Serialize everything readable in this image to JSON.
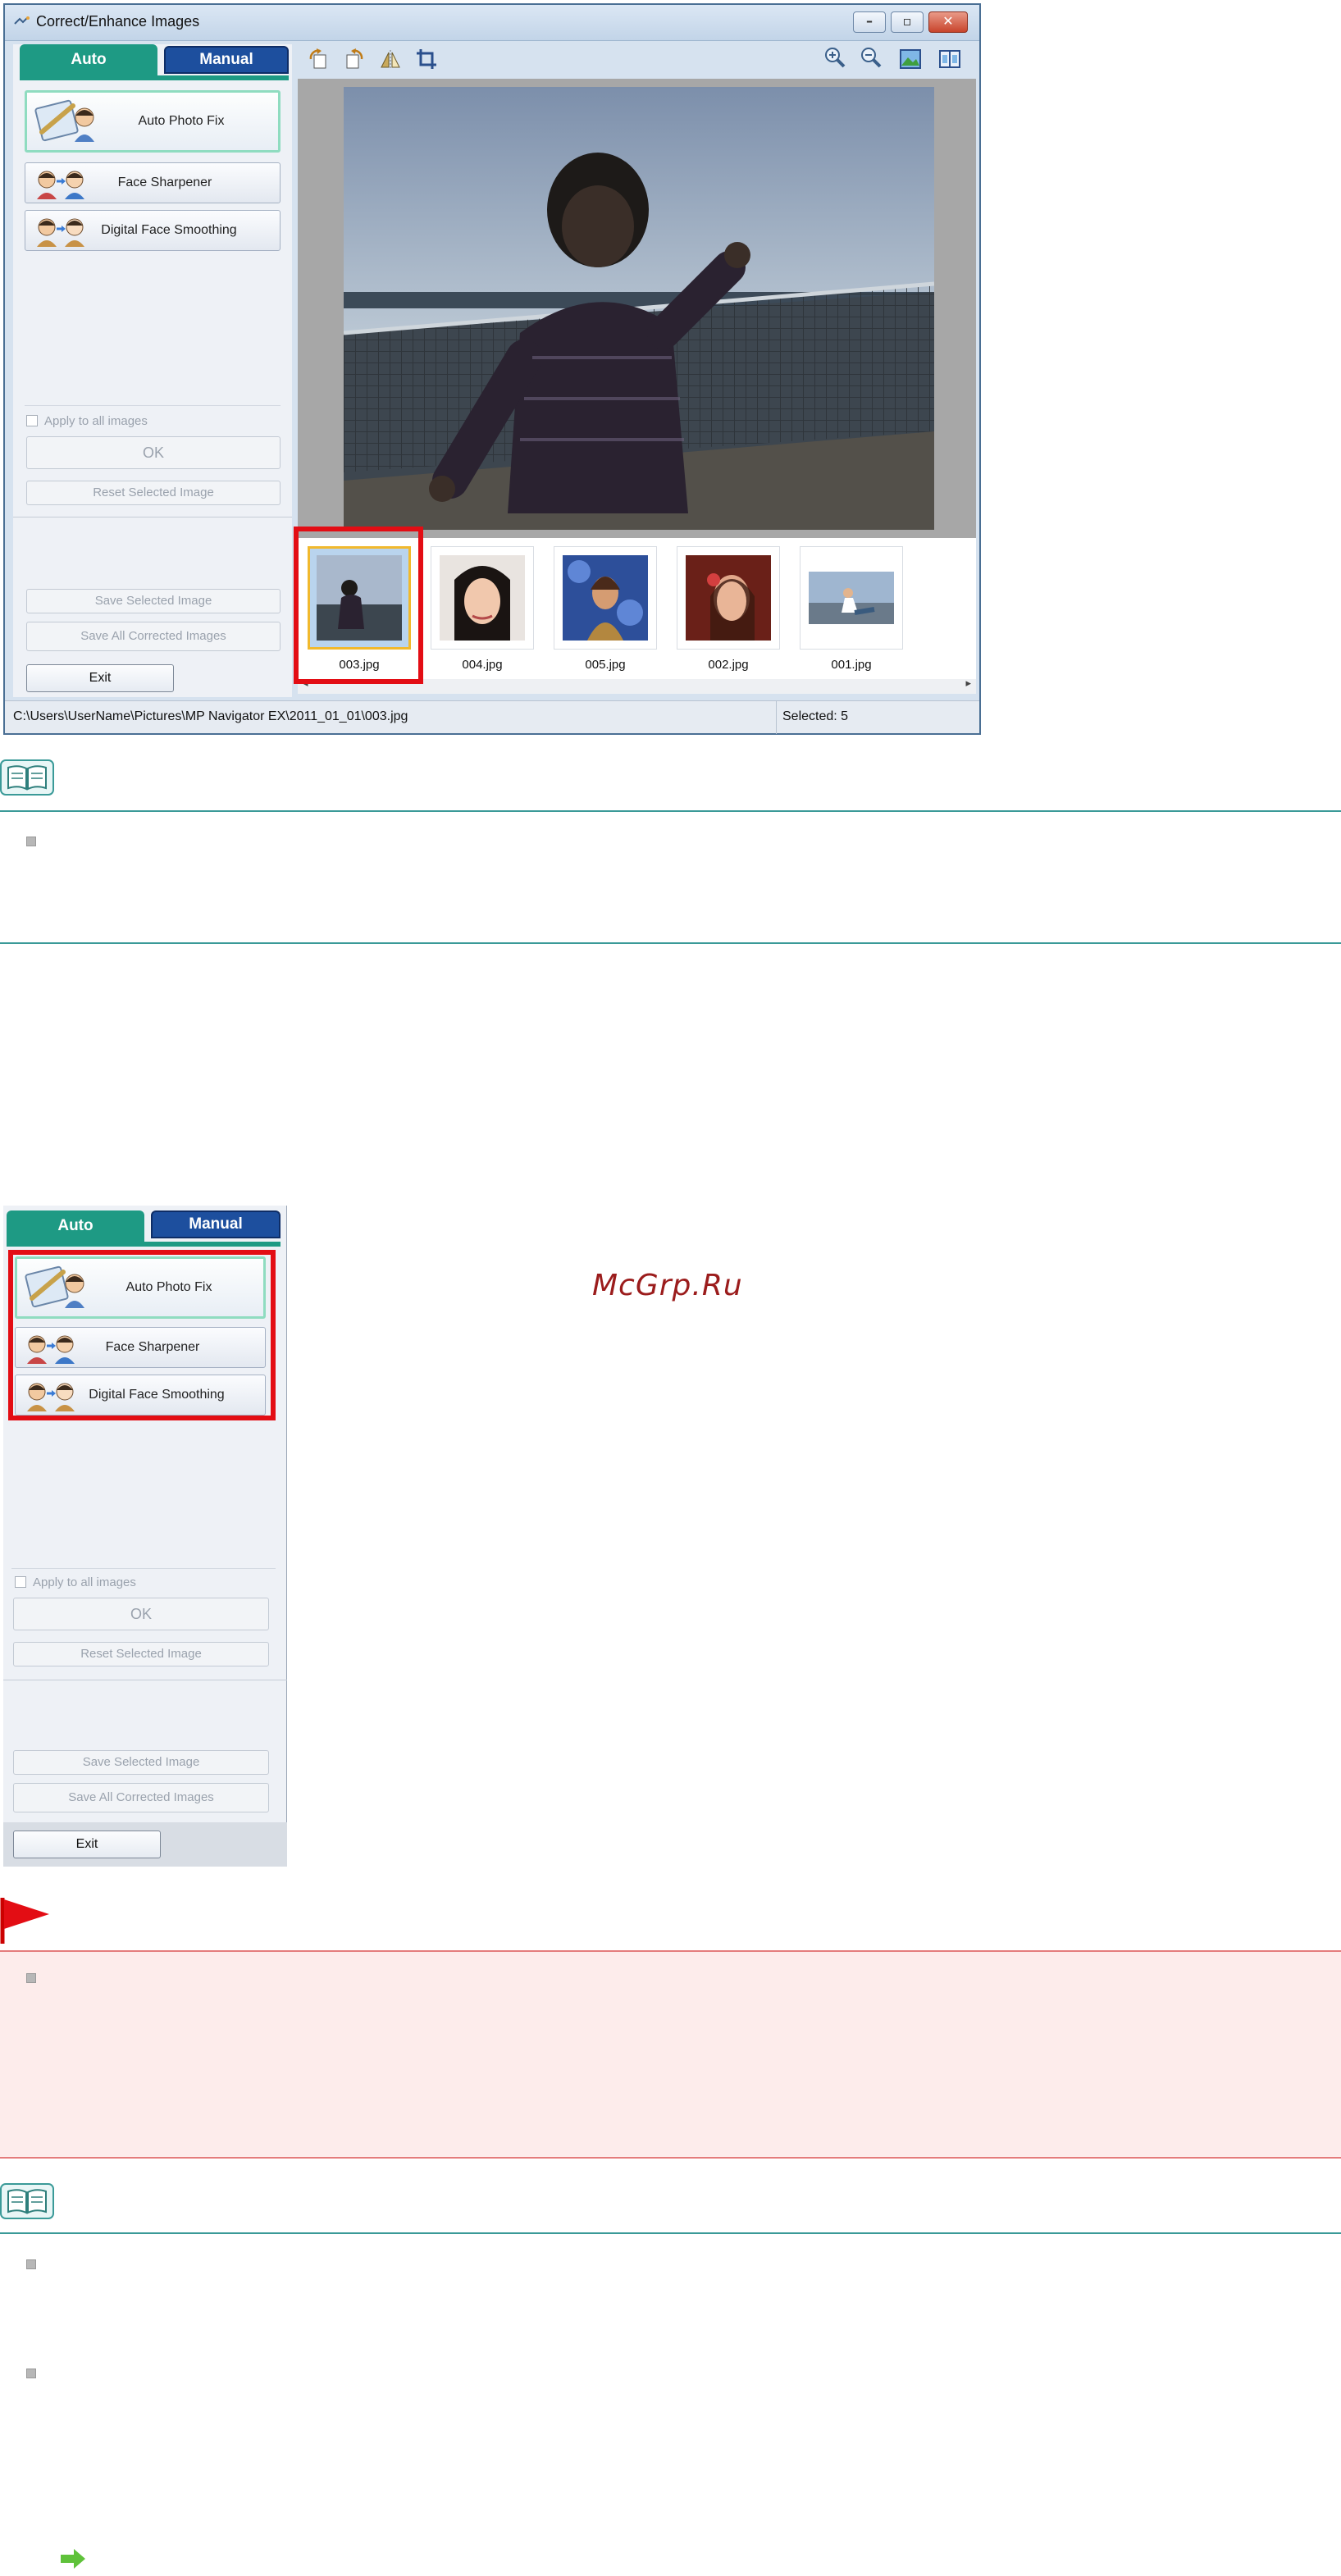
{
  "window": {
    "title": "Correct/Enhance Images",
    "controls": [
      "minimize",
      "restore",
      "close"
    ]
  },
  "tabs": {
    "auto": "Auto",
    "manual": "Manual"
  },
  "functions": [
    {
      "label": "Auto Photo Fix",
      "icon": "auto-photo-fix-icon"
    },
    {
      "label": "Face Sharpener",
      "icon": "face-sharpener-icon"
    },
    {
      "label": "Digital Face Smoothing",
      "icon": "digital-face-smoothing-icon"
    }
  ],
  "controls": {
    "apply_all": "Apply to all images",
    "ok": "OK",
    "reset": "Reset Selected Image",
    "save_selected": "Save Selected Image",
    "save_all": "Save All Corrected Images",
    "exit": "Exit"
  },
  "toolbar": {
    "left_icons": [
      "rotate-left-icon",
      "rotate-right-icon",
      "invert-icon",
      "trim-icon"
    ],
    "right_icons": [
      "zoom-in-icon",
      "zoom-out-icon",
      "view-full-screen-icon",
      "compare-icon"
    ]
  },
  "thumbnails": [
    "003.jpg",
    "004.jpg",
    "005.jpg",
    "002.jpg",
    "001.jpg"
  ],
  "status": {
    "path": "C:\\Users\\UserName\\Pictures\\MP Navigator EX\\2011_01_01\\003.jpg",
    "selected": "Selected: 5"
  },
  "watermark": "McGrp.Ru",
  "colors": {
    "auto_tab": "#1e9a84",
    "manual_tab": "#1d4f9e",
    "highlight": "#e30d14",
    "note_rule": "#3a9a98",
    "warning_bg": "#fdeceb"
  }
}
